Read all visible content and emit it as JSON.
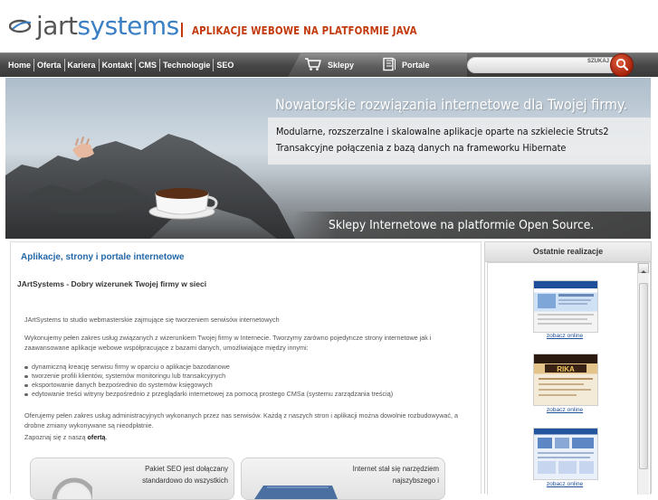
{
  "header": {
    "logo_text_1": "jart",
    "logo_text_2": "systems",
    "tagline": "APLIKACJE WEBOWE NA PLATFORMIE JAVA"
  },
  "nav": {
    "items": [
      "Home",
      "Oferta",
      "Kariera",
      "Kontakt",
      "CMS",
      "Technologie",
      "SEO"
    ],
    "shops_label": "Sklepy",
    "portals_label": "Portale",
    "search_button_label": "SZUKAJ"
  },
  "hero": {
    "headline": "Nowatorskie rozwiązania internetowe dla Twojej firmy.",
    "line1": "Modularne, rozszerzalne i skalowalne aplikacje oparte na szkielecie Struts2",
    "line2": "Transakcyjne połączenia z bazą danych na frameworku Hibernate",
    "footer": "Sklepy Internetowe na platformie Open Source."
  },
  "main": {
    "title": "Aplikacje, strony i portale internetowe",
    "subtitle": "JArtSystems - Dobry wizerunek Twojej firmy w sieci",
    "p1": "JArtSystems to studio webmasterskie zajmujące się tworzeniem serwisów internetowych",
    "p2": "Wykonujemy pełen zakres usług związanych z wizerunkiem Twojej firmy w Internecie. Tworzymy zarówno pojedyncze strony internetowe jak i zaawansowane aplikacje webowe współpracujące z bazami danych, umożliwiające między innymi:",
    "bullets": [
      "dynamiczną kreację serwisu firmy w oparciu o aplikacje bazodanowe",
      "tworzenie profili klientów, systemów monitoringu lub transakcyjnych",
      "eksportowanie danych bezpośrednio do systemów księgowych",
      "edytowanie treści witryny bezpośrednio z przeglądarki internetowej za pomocą prostego CMSa (systemu zarządzania treścią)"
    ],
    "p3": "Oferujemy pełen zakres usług administracyjnych wykonanych przez nas serwisów. Każdą z naszych stron i aplikacji można dowolnie rozbudowywać, a drobne zmiany wykonywane są nieodpłatnie.",
    "offer_prefix": "Zapoznaj się z naszą ",
    "offer_link": "ofertą",
    "offer_suffix": ".",
    "promo1_line1": "Pakiet SEO jest dołączany",
    "promo1_line2": "standardowo do wszystkich",
    "promo2_line1": "Internet stał się narzędziem",
    "promo2_line2": "najszybszego i"
  },
  "sidebar": {
    "title": "Ostatnie realizacje",
    "see_online": [
      "zobacz online",
      "zobacz online",
      "zobacz online"
    ]
  },
  "colors": {
    "brand_blue": "#3b7fc4",
    "accent_red": "#c23a0e",
    "title_blue": "#2367a8",
    "nav_dark": "#454545"
  }
}
